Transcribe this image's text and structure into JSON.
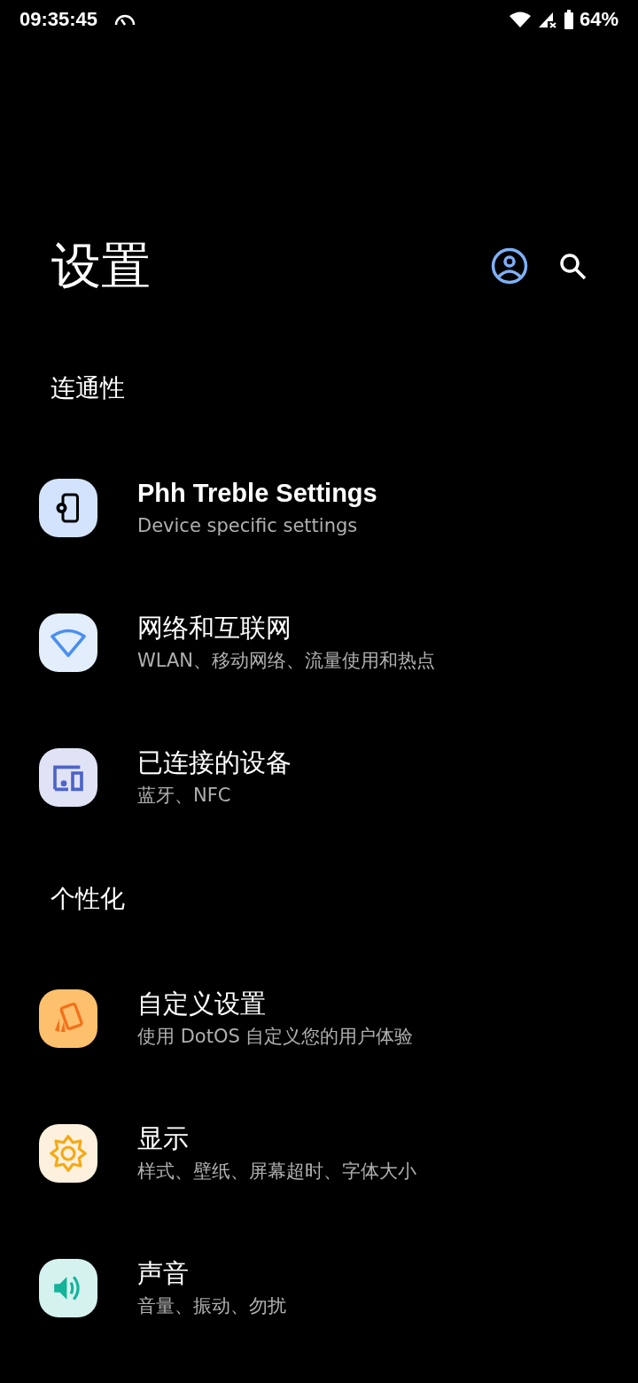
{
  "status_bar": {
    "time": "09:35:45",
    "battery": "64%"
  },
  "title": "设置",
  "sections": [
    {
      "header": "连通性",
      "items": [
        {
          "title": "Phh Treble Settings",
          "subtitle": "Device specific settings"
        },
        {
          "title": "网络和互联网",
          "subtitle": "WLAN、移动网络、流量使用和热点"
        },
        {
          "title": "已连接的设备",
          "subtitle": "蓝牙、NFC"
        }
      ]
    },
    {
      "header": "个性化",
      "items": [
        {
          "title": "自定义设置",
          "subtitle": "使用 DotOS 自定义您的用户体验"
        },
        {
          "title": "显示",
          "subtitle": "样式、壁纸、屏幕超时、字体大小"
        },
        {
          "title": "声音",
          "subtitle": "音量、振动、勿扰"
        }
      ]
    }
  ]
}
